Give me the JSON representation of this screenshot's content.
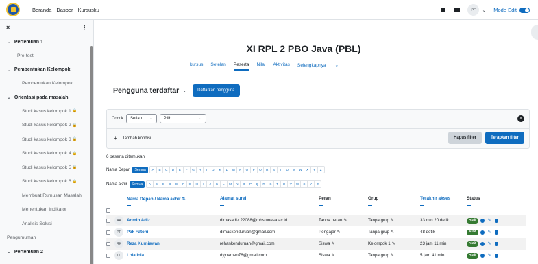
{
  "topbar": {
    "nav": [
      "Beranda",
      "Dasbor",
      "Kursusku"
    ],
    "avatar": "PF",
    "mode_edit": "Mode Edit"
  },
  "drawer": {
    "close_label": "×",
    "sections": [
      {
        "title": "Pertemuan 1",
        "items": [
          {
            "label": "Pre-test",
            "locked": false
          }
        ]
      },
      {
        "title": "Pembentukan Kelompok",
        "items": [
          {
            "label": "Pembentukan Kelompok",
            "locked": false
          }
        ]
      },
      {
        "title": "Orientasi pada masalah",
        "items": [
          {
            "label": "Studi kasus kelompok 1",
            "locked": true
          },
          {
            "label": "Studi kasus kelompok 2",
            "locked": true
          },
          {
            "label": "Studi kasus kelompok 3",
            "locked": true
          },
          {
            "label": "Studi kasus kelompok 4",
            "locked": true
          },
          {
            "label": "Studi kasus kelompok 5",
            "locked": true
          },
          {
            "label": "Studi kasus kelompok 6",
            "locked": true
          }
        ]
      }
    ],
    "loose_items": [
      "Membuat Rumusan Masalah",
      "Menentukan Indikator",
      "Analisis Solusi"
    ],
    "announcements": "Pengumuman",
    "next_section": "Pertemuan 2"
  },
  "course": {
    "title": "XI RPL 2 PBO Java (PBL)",
    "tabs": [
      "kursus",
      "Setelan",
      "Peserta",
      "Nilai",
      "Aktivitas",
      "Selengkapnya"
    ],
    "active_tab": "Peserta"
  },
  "participants": {
    "heading": "Pengguna terdaftar",
    "enrol_button": "Daftarkan pengguna"
  },
  "filter": {
    "match_label": "Cocok",
    "match_value": "Setiap",
    "choose_value": "Pilih",
    "add_condition": "Tambah kondisi",
    "clear_button": "Hapus filter",
    "apply_button": "Terapkan filter"
  },
  "found_text": "6 peserta ditemukan",
  "alpha": {
    "first_label": "Nama Depan",
    "last_label": "Nama akhir",
    "all_label": "Semua",
    "letters": [
      "A",
      "B",
      "C",
      "D",
      "E",
      "F",
      "G",
      "H",
      "I",
      "J",
      "K",
      "L",
      "M",
      "N",
      "O",
      "P",
      "Q",
      "R",
      "S",
      "T",
      "U",
      "V",
      "W",
      "X",
      "Y",
      "Z"
    ]
  },
  "table": {
    "headers": {
      "name": "Nama Depan / Nama akhir",
      "email": "Alamat surel",
      "role": "Peran",
      "group": "Grup",
      "last": "Terakhir akses",
      "status": "Status"
    },
    "rows": [
      {
        "initials": "AA",
        "name": "Admin Adiz",
        "email": "dimasadiz.22088@mhs.unesa.ac.id",
        "role": "Tanpa peran",
        "group": "Tanpa grup",
        "last": "33 min 20 detik",
        "status": "Aktif"
      },
      {
        "initials": "PF",
        "name": "Pak Fatoni",
        "email": "dimaskenduruan@gmail.com",
        "role": "Pengajar",
        "group": "Tanpa grup",
        "last": "48 detik",
        "status": "Aktif"
      },
      {
        "initials": "RK",
        "name": "Reza Kurniawan",
        "email": "rehankenduruan@gmail.com",
        "role": "Siswa",
        "group": "Kelompok 1",
        "last": "23 jam 11 min",
        "status": "Aktif"
      },
      {
        "initials": "LL",
        "name": "Lola lola",
        "email": "dyjnamen76@gmail.com",
        "role": "Siswa",
        "group": "Tanpa grup",
        "last": "5 jam 41 min",
        "status": "Aktif"
      }
    ]
  }
}
